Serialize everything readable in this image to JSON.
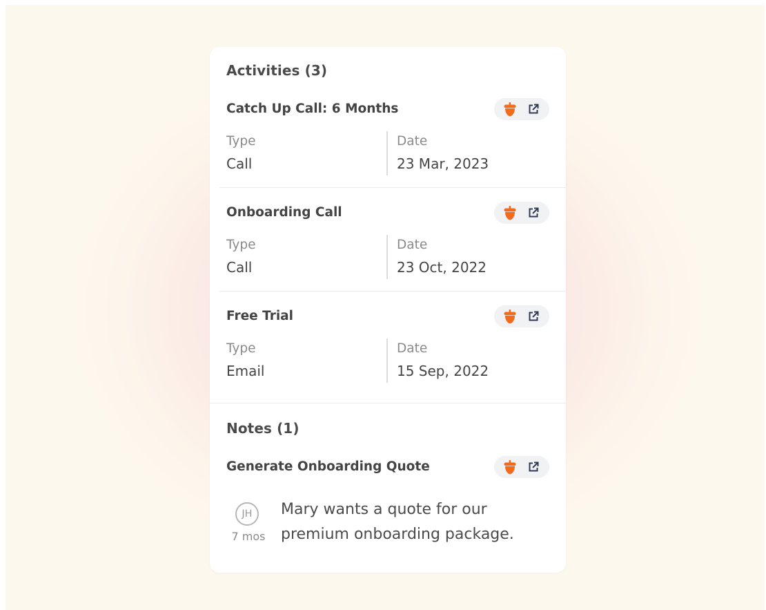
{
  "activities": {
    "header": "Activities (3)",
    "items": [
      {
        "title": "Catch Up Call: 6 Months",
        "type_label": "Type",
        "type_value": "Call",
        "date_label": "Date",
        "date_value": "23 Mar, 2023"
      },
      {
        "title": "Onboarding Call",
        "type_label": "Type",
        "type_value": "Call",
        "date_label": "Date",
        "date_value": "23 Oct, 2022"
      },
      {
        "title": "Free Trial",
        "type_label": "Type",
        "type_value": "Email",
        "date_label": "Date",
        "date_value": "15 Sep, 2022"
      }
    ]
  },
  "notes": {
    "header": "Notes (1)",
    "items": [
      {
        "title": "Generate Onboarding Quote",
        "author_initials": "JH",
        "time_ago": "7 mos",
        "text": "Mary wants a quote for our premium onboarding package."
      }
    ]
  },
  "icons": {
    "app_icon": "acorn-icon",
    "open_icon": "external-link-icon"
  },
  "colors": {
    "accent": "#f26a1b",
    "icon_dark": "#2f3b52",
    "pill_bg": "#f1f2f4"
  }
}
